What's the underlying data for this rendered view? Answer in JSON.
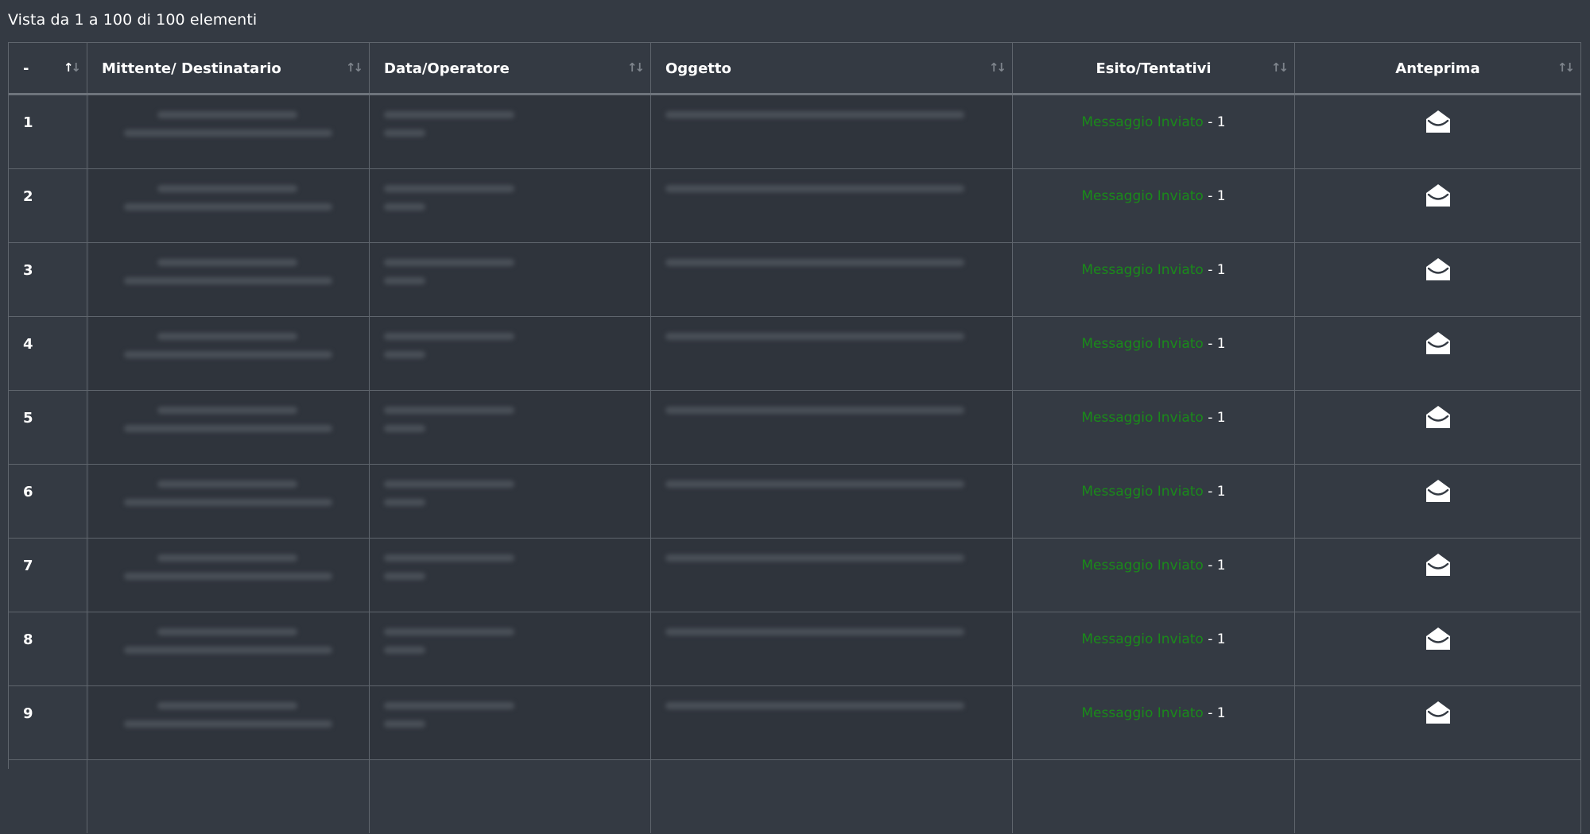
{
  "info": "Vista da 1 a 100 di 100 elementi",
  "columns": {
    "index": "-",
    "sender": "Mittente/ Destinatario",
    "date": "Data/Operatore",
    "subject": "Oggetto",
    "status": "Esito/Tentativi",
    "preview": "Anteprima"
  },
  "icons": {
    "sort": "sort-arrows-icon",
    "preview": "envelope-open-icon"
  },
  "colors": {
    "success": "#1a8a1a",
    "background": "#343a43"
  },
  "rows": [
    {
      "n": "1",
      "status": "Messaggio Inviato",
      "sep": " - ",
      "tries": "1"
    },
    {
      "n": "2",
      "status": "Messaggio Inviato",
      "sep": " - ",
      "tries": "1"
    },
    {
      "n": "3",
      "status": "Messaggio Inviato",
      "sep": " - ",
      "tries": "1"
    },
    {
      "n": "4",
      "status": "Messaggio Inviato",
      "sep": " - ",
      "tries": "1"
    },
    {
      "n": "5",
      "status": "Messaggio Inviato",
      "sep": " - ",
      "tries": "1"
    },
    {
      "n": "6",
      "status": "Messaggio Inviato",
      "sep": " - ",
      "tries": "1"
    },
    {
      "n": "7",
      "status": "Messaggio Inviato",
      "sep": " - ",
      "tries": "1"
    },
    {
      "n": "8",
      "status": "Messaggio Inviato",
      "sep": " - ",
      "tries": "1"
    },
    {
      "n": "9",
      "status": "Messaggio Inviato",
      "sep": " - ",
      "tries": "1"
    }
  ]
}
